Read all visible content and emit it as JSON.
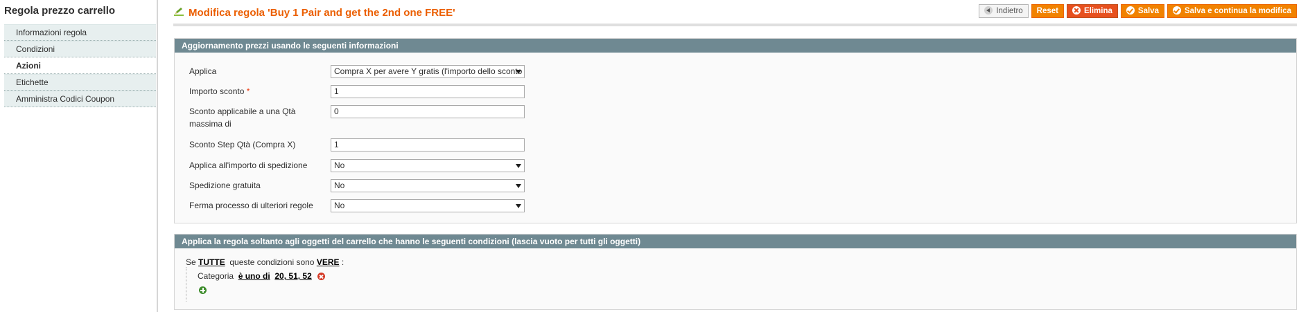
{
  "sidebar": {
    "title": "Regola prezzo carrello",
    "tabs": [
      {
        "label": "Informazioni regola"
      },
      {
        "label": "Condizioni"
      },
      {
        "label": "Azioni"
      },
      {
        "label": "Etichette"
      },
      {
        "label": "Amministra Codici Coupon"
      }
    ],
    "active_tab": "Azioni"
  },
  "header": {
    "title": "Modifica regola 'Buy 1 Pair and get the 2nd one FREE'",
    "buttons": {
      "back": "Indietro",
      "reset": "Reset",
      "delete": "Elimina",
      "save": "Salva",
      "save_continue": "Salva e continua la modifica"
    }
  },
  "actions_section": {
    "title": "Aggiornamento prezzi usando le seguenti informazioni",
    "apply": {
      "label": "Applica",
      "value": "Compra X per avere Y gratis (l'importo dello sconto è Y)"
    },
    "discount_amount": {
      "label": "Importo sconto",
      "required_mark": "*",
      "value": "1"
    },
    "max_qty": {
      "label": "Sconto applicabile a una Qtà massima di",
      "value": "0"
    },
    "discount_step": {
      "label": "Sconto Step Qtà (Compra X)",
      "value": "1"
    },
    "apply_to_shipping": {
      "label": "Applica all'importo di spedizione",
      "value": "No"
    },
    "free_shipping": {
      "label": "Spedizione gratuita",
      "value": "No"
    },
    "stop_rules": {
      "label": "Ferma processo di ulteriori regole",
      "value": "No"
    }
  },
  "conditions_section": {
    "title": "Applica la regola soltanto agli oggetti del carrello che hanno le seguenti condizioni (lascia vuoto per tutti gli oggetti)",
    "prefix": "Se",
    "aggregator": "TUTTE",
    "middle": "queste condizioni sono",
    "value": "VERE",
    "suffix": ":",
    "condition": {
      "attribute": "Categoria",
      "operator": "è uno di",
      "value": "20, 51, 52"
    }
  },
  "colors": {
    "accent": "#eb5e00",
    "button": "#f18200",
    "delete": "#e7501e",
    "section_header": "#6f8992"
  }
}
